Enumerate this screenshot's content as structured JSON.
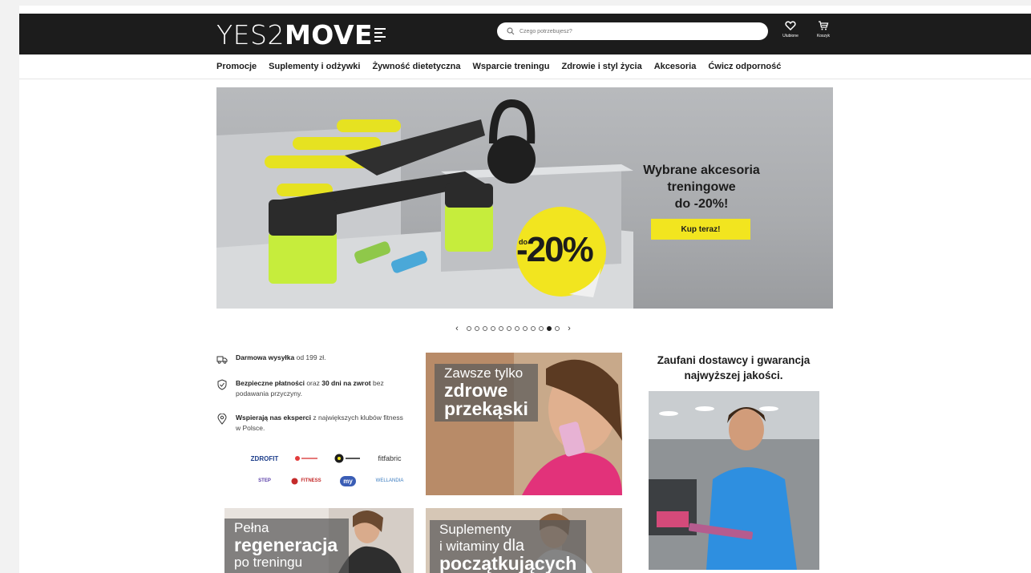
{
  "header": {
    "logo_light": "YES2",
    "logo_bold": "MOVE",
    "search_placeholder": "Czego potrzebujesz?",
    "favorites_label": "Ulubione",
    "cart_label": "Koszyk"
  },
  "nav": {
    "items": [
      "Promocje",
      "Suplementy i odżywki",
      "Żywność dietetyczna",
      "Wsparcie treningu",
      "Zdrowie i styl życia",
      "Akcesoria",
      "Ćwicz odporność"
    ]
  },
  "hero": {
    "line1": "Wybrane akcesoria",
    "line2": "treningowe",
    "line3": "do -20%!",
    "cta": "Kup teraz!",
    "badge_prefix": "do",
    "badge_value": "-20%"
  },
  "carousel": {
    "prev": "‹",
    "next": "›",
    "dot_count": 12,
    "active_index": 10
  },
  "features": {
    "shipping_bold": "Darmowa wysyłka",
    "shipping_rest": " od 199 zł.",
    "payment_bold": "Bezpieczne płatności",
    "payment_mid": " oraz ",
    "payment_bold2": "30 dni na zwrot",
    "payment_rest": " bez podawania przyczyny.",
    "experts_bold": "Wspierają nas eksperci",
    "experts_rest": " z największych klubów fitness w Polsce."
  },
  "partners": [
    "ZDROFIT",
    "",
    "",
    "fitfabric",
    "STEP",
    "FITNESS",
    "my",
    "WELLANDIA"
  ],
  "tiles": {
    "snacks_light": "Zawsze tylko",
    "snacks_bold1": "zdrowe",
    "snacks_bold2": "przekąski",
    "regen_light": "Pełna",
    "regen_bold": "regeneracja",
    "regen_light2": "po treningu",
    "supp_light1": "Suplementy",
    "supp_light2": "i witaminy",
    "supp_bold1": "dla",
    "supp_bold2": "początkujących"
  },
  "trust": {
    "title_line1": "Zaufani dostawcy i gwarancja",
    "title_line2": "najwyższej jakości."
  },
  "colors": {
    "topbar": "#1c1c1c",
    "accent_yellow": "#f2e51f",
    "lime": "#c6ed3c"
  }
}
